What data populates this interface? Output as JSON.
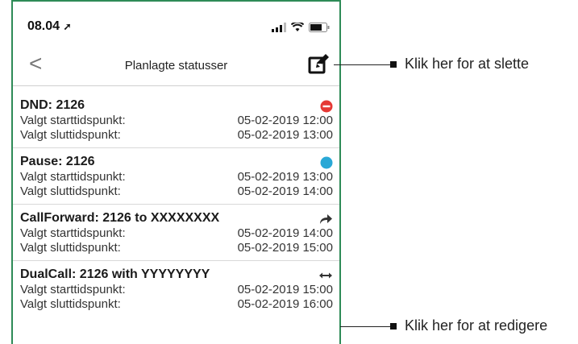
{
  "status_bar": {
    "time": "08.04"
  },
  "nav": {
    "back_glyph": "<",
    "title": "Planlagte statusser"
  },
  "items": [
    {
      "title": "DND: 2126",
      "indicator": "red-minus-circle-icon",
      "start_label": "Valgt starttidspunkt:",
      "start_value": "05-02-2019 12:00",
      "end_label": "Valgt sluttidspunkt:",
      "end_value": "05-02-2019 13:00"
    },
    {
      "title": "Pause: 2126",
      "indicator": "blue-dot-icon",
      "start_label": "Valgt starttidspunkt:",
      "start_value": "05-02-2019 13:00",
      "end_label": "Valgt sluttidspunkt:",
      "end_value": "05-02-2019 14:00"
    },
    {
      "title": "CallForward: 2126 to XXXXXXXX",
      "indicator": "forward-arrow-icon",
      "start_label": "Valgt starttidspunkt:",
      "start_value": "05-02-2019 14:00",
      "end_label": "Valgt sluttidspunkt:",
      "end_value": "05-02-2019 15:00"
    },
    {
      "title": "DualCall: 2126 with YYYYYYYY",
      "indicator": "left-right-arrow-icon",
      "start_label": "Valgt starttidspunkt:",
      "start_value": "05-02-2019 15:00",
      "end_label": "Valgt sluttidspunkt:",
      "end_value": "05-02-2019 16:00"
    }
  ],
  "callouts": {
    "delete": "Klik her for at slette",
    "edit": "Klik her for at redigere"
  },
  "colors": {
    "frame": "#2e8b57",
    "dnd": "#e53935",
    "pause": "#29a8d6"
  }
}
